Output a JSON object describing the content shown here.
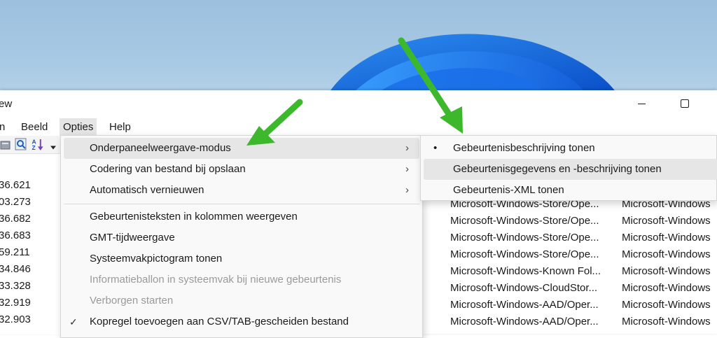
{
  "window": {
    "title_fragment": "ew",
    "controls": {
      "minimize_icon": "minimize-icon",
      "maximize_icon": "maximize-icon"
    }
  },
  "menubar": {
    "items": [
      {
        "label": "n"
      },
      {
        "label": "Beeld"
      },
      {
        "label": "Opties"
      },
      {
        "label": "Help"
      }
    ]
  },
  "toolbar": {
    "icons": [
      "properties-icon",
      "find-icon",
      "sort-az-icon",
      "dropdown-caret-icon"
    ]
  },
  "left_column": {
    "values": [
      "36.621",
      "03.273",
      "36.682",
      "36.683",
      "59.211",
      "34.846",
      "33.328",
      "32.919",
      "32.903"
    ]
  },
  "options_menu": {
    "items": [
      {
        "label": "Onderpaneelweergave-modus",
        "arrow": "›"
      },
      {
        "label": "Codering van bestand bij opslaan",
        "arrow": "›"
      },
      {
        "label": "Automatisch vernieuwen",
        "arrow": "›"
      },
      {
        "label": "Gebeurtenisteksten in kolommen weergeven"
      },
      {
        "label": "GMT-tijdweergave"
      },
      {
        "label": "Systeemvakpictogram tonen"
      },
      {
        "label": "Informatieballon in systeemvak bij nieuwe gebeurtenis"
      },
      {
        "label": "Verborgen starten"
      },
      {
        "label": "Kopregel toevoegen aan CSV/TAB-gescheiden bestand",
        "check": "✓"
      }
    ]
  },
  "submenu": {
    "items": [
      {
        "label": "Gebeurtenisbeschrijving tonen",
        "bullet": "•"
      },
      {
        "label": "Gebeurtenisgegevens en -beschrijving tonen"
      },
      {
        "label": "Gebeurtenis-XML tonen"
      }
    ]
  },
  "table_rows": [
    {
      "col1": "Microsoft-Windows-Store/Ope...",
      "col2": "Microsoft-Windows"
    },
    {
      "col1": "Microsoft-Windows-Store/Ope...",
      "col2": "Microsoft-Windows"
    },
    {
      "col1": "Microsoft-Windows-Store/Ope...",
      "col2": "Microsoft-Windows"
    },
    {
      "col1": "Microsoft-Windows-Store/Ope...",
      "col2": "Microsoft-Windows"
    },
    {
      "col1": "Microsoft-Windows-Known Fol...",
      "col2": "Microsoft-Windows"
    },
    {
      "col1": "Microsoft-Windows-CloudStor...",
      "col2": "Microsoft-Windows"
    },
    {
      "col1": "Microsoft-Windows-AAD/Oper...",
      "col2": "Microsoft-Windows"
    },
    {
      "col1": "Microsoft-Windows-AAD/Oper...",
      "col2": "Microsoft-Windows"
    }
  ],
  "colors": {
    "annotation_arrow": "#3db82c",
    "wallpaper_bloom": "#1f6fe0",
    "menu_hover": "#e6e6e6"
  }
}
